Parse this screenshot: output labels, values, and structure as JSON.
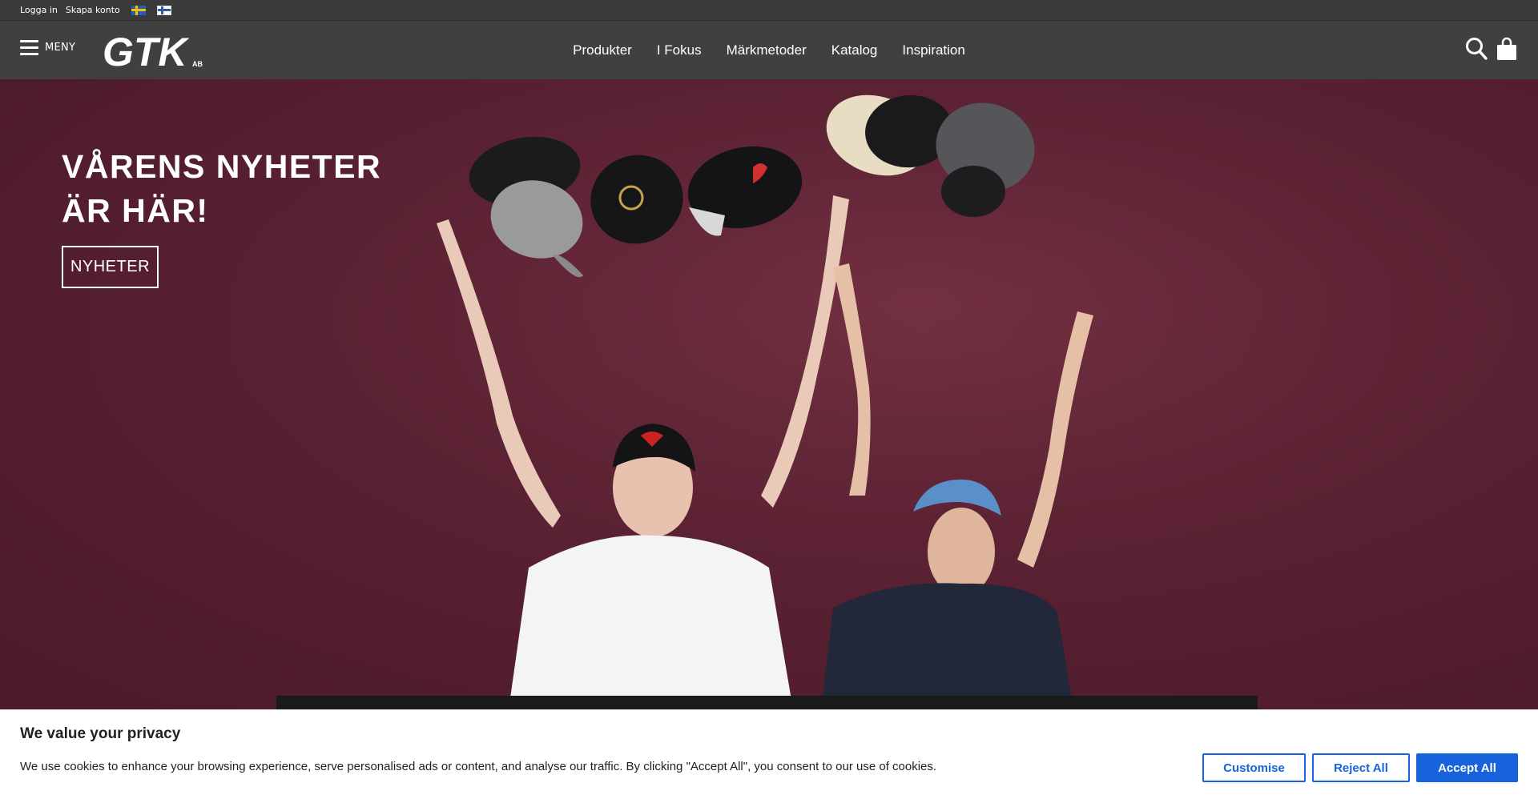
{
  "topbar": {
    "login": "Logga in",
    "create_account": "Skapa konto",
    "languages": [
      "sv",
      "fi"
    ]
  },
  "header": {
    "menu_label": "MENY",
    "logo_text": "GTK",
    "logo_suffix": "AB",
    "nav": [
      "Produkter",
      "I Fokus",
      "Märkmetoder",
      "Katalog",
      "Inspiration"
    ],
    "icons": [
      "search-icon",
      "shopping-bag-icon"
    ]
  },
  "hero": {
    "title_line1": "VÅRENS NYHETER",
    "title_line2": "ÄR HÄR!",
    "button": "NYHETER",
    "background_color": "#5a2132"
  },
  "cookie": {
    "title": "We value your privacy",
    "text": "We use cookies to enhance your browsing experience, serve personalised ads or content, and analyse our traffic. By clicking \"Accept All\", you consent to our use of cookies.",
    "customise": "Customise",
    "reject": "Reject All",
    "accept": "Accept All",
    "accent_color": "#1863dc"
  }
}
